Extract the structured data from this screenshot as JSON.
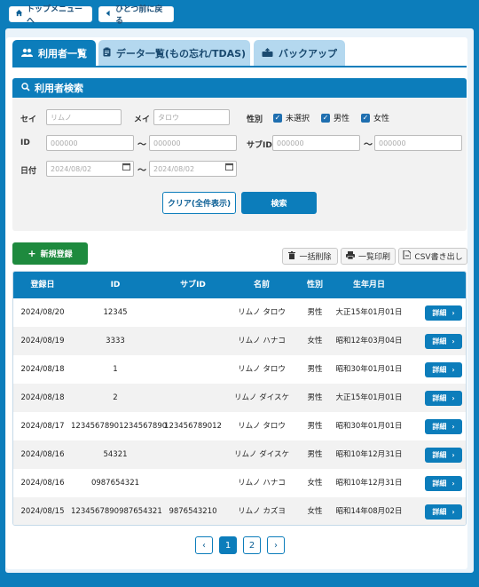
{
  "nav": {
    "top_menu": "トップメニューへ",
    "back": "ひとつ前に戻る"
  },
  "tabs": [
    {
      "label": "利用者一覧",
      "icon": "users-icon"
    },
    {
      "label": "データ一覧(もの忘れ/TDAS)",
      "icon": "clipboard-icon"
    },
    {
      "label": "バックアップ",
      "icon": "backup-icon"
    }
  ],
  "search": {
    "title": "利用者検索",
    "sei_label": "セイ",
    "sei_placeholder": "リムノ",
    "mei_label": "メイ",
    "mei_placeholder": "タロウ",
    "gender_label": "性別",
    "gender_options": [
      "未選択",
      "男性",
      "女性"
    ],
    "id_label": "ID",
    "id_from_placeholder": "000000",
    "id_to_placeholder": "000000",
    "subid_label": "サブID",
    "subid_from_placeholder": "000000",
    "subid_to_placeholder": "000000",
    "date_label": "日付",
    "date_from_placeholder": "2024/08/02",
    "date_to_placeholder": "2024/08/02",
    "tilde": "〜",
    "clear_button": "クリア(全件表示)",
    "search_button": "検索"
  },
  "actions": {
    "new_button": "新規登録",
    "bulk_delete": "一括削除",
    "print_list": "一覧印刷",
    "csv_export": "CSV書き出し"
  },
  "table": {
    "headers": [
      "登録日",
      "ID",
      "サブID",
      "名前",
      "性別",
      "生年月日"
    ],
    "detail_label": "詳細",
    "rows": [
      {
        "date": "2024/08/20",
        "id": "12345",
        "subid": "",
        "name": "リムノ タロウ",
        "gender": "男性",
        "birth": "大正15年01月01日"
      },
      {
        "date": "2024/08/19",
        "id": "3333",
        "subid": "",
        "name": "リムノ ハナコ",
        "gender": "女性",
        "birth": "昭和12年03月04日"
      },
      {
        "date": "2024/08/18",
        "id": "1",
        "subid": "",
        "name": "リムノ タロウ",
        "gender": "男性",
        "birth": "昭和30年01月01日"
      },
      {
        "date": "2024/08/18",
        "id": "2",
        "subid": "",
        "name": "リムノ ダイスケ",
        "gender": "男性",
        "birth": "大正15年01月01日"
      },
      {
        "date": "2024/08/17",
        "id": "12345678901234567890",
        "subid": "123456789012",
        "name": "リムノ タロウ",
        "gender": "男性",
        "birth": "昭和30年01月01日"
      },
      {
        "date": "2024/08/16",
        "id": "54321",
        "subid": "",
        "name": "リムノ ダイスケ",
        "gender": "男性",
        "birth": "昭和10年12月31日"
      },
      {
        "date": "2024/08/16",
        "id": "0987654321",
        "subid": "",
        "name": "リムノ ハナコ",
        "gender": "女性",
        "birth": "昭和10年12月31日"
      },
      {
        "date": "2024/08/15",
        "id": "1234567890987654321",
        "subid": "9876543210",
        "name": "リムノ カズヨ",
        "gender": "女性",
        "birth": "昭和14年08月02日"
      }
    ]
  },
  "pagination": {
    "prev": "‹",
    "pages": [
      "1",
      "2"
    ],
    "current": "1",
    "next": "›"
  },
  "colors": {
    "primary": "#0c7dbb",
    "tab_inactive": "#b4d8ef",
    "new_button": "#1e8a3e",
    "panel_bg": "#eaf3fa"
  }
}
